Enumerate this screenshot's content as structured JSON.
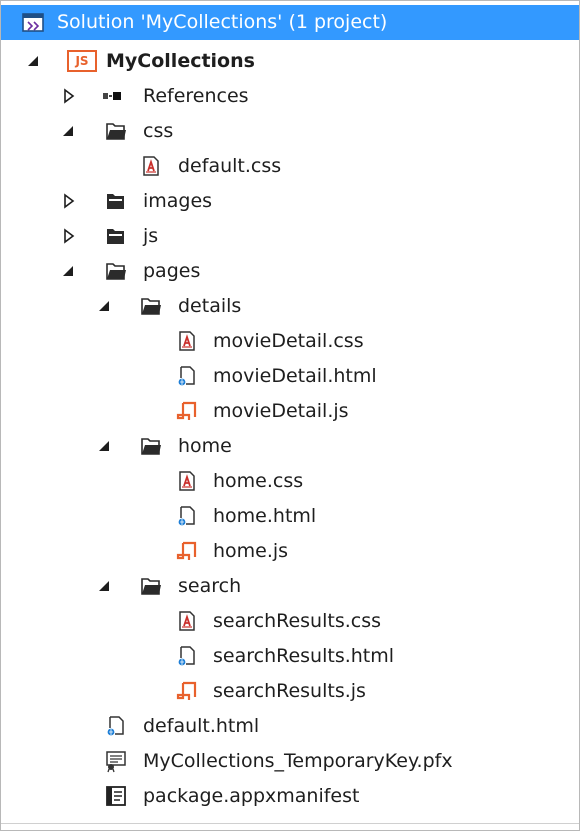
{
  "solution": {
    "label": "Solution 'MyCollections' (1 project)"
  },
  "project": {
    "label": "MyCollections",
    "badge": "JS"
  },
  "tree": {
    "references": "References",
    "css": "css",
    "default_css": "default.css",
    "images": "images",
    "js": "js",
    "pages": "pages",
    "details": "details",
    "movieDetail_css": "movieDetail.css",
    "movieDetail_html": "movieDetail.html",
    "movieDetail_js": "movieDetail.js",
    "home": "home",
    "home_css": "home.css",
    "home_html": "home.html",
    "home_js": "home.js",
    "search": "search",
    "searchResults_css": "searchResults.css",
    "searchResults_html": "searchResults.html",
    "searchResults_js": "searchResults.js",
    "default_html": "default.html",
    "temp_key": "MyCollections_TemporaryKey.pfx",
    "manifest": "package.appxmanifest"
  },
  "colors": {
    "selection": "#3399ff",
    "js_orange": "#e8612c",
    "css_red": "#c9302c",
    "html_blue": "#1c7ed6",
    "folder": "#333333"
  }
}
